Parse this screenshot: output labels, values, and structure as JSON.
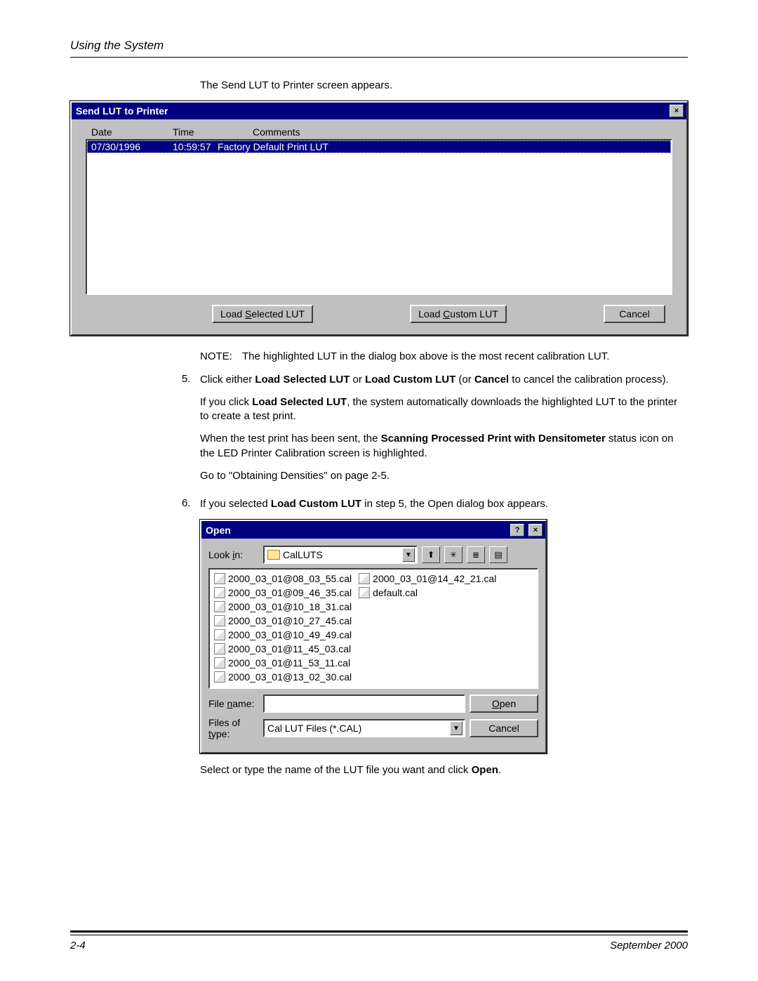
{
  "header": {
    "title": "Using the System"
  },
  "intro": "The Send LUT to Printer screen appears.",
  "dlg1": {
    "title": "Send LUT to Printer",
    "close": "×",
    "cols": {
      "date": "Date",
      "time": "Time",
      "comments": "Comments"
    },
    "row": {
      "date": "07/30/1996",
      "time": "10:59:57",
      "comments": "Factory Default Print LUT"
    },
    "btn_load_sel_pre": "Load ",
    "btn_load_sel_u": "S",
    "btn_load_sel_post": "elected LUT",
    "btn_load_cus_pre": "Load ",
    "btn_load_cus_u": "C",
    "btn_load_cus_post": "ustom LUT",
    "btn_cancel": "Cancel"
  },
  "note": {
    "label": "NOTE:",
    "text": "The highlighted LUT in the dialog box above is the most recent calibration LUT."
  },
  "step5": {
    "num": "5.",
    "p1a": "Click either ",
    "p1b": "Load Selected LUT",
    "p1c": " or ",
    "p1d": "Load Custom LUT",
    "p1e": " (or ",
    "p1f": "Cancel",
    "p1g": " to cancel the calibration process).",
    "p2a": "If you click ",
    "p2b": "Load Selected LUT",
    "p2c": ", the system automatically downloads the highlighted LUT to the printer to create a test print.",
    "p3a": "When the test print has been sent, the ",
    "p3b": "Scanning Processed Print with Densitometer",
    "p3c": " status icon on the LED Printer Calibration screen is highlighted.",
    "p4": "Go to \"Obtaining Densities\" on page 2-5."
  },
  "step6": {
    "num": "6.",
    "p1a": "If you selected ",
    "p1b": "Load Custom LUT",
    "p1c": " in step 5, the Open dialog box appears."
  },
  "openDlg": {
    "title": "Open",
    "help": "?",
    "close": "×",
    "lookin_pre": "Look ",
    "lookin_u": "i",
    "lookin_post": "n:",
    "folder": "CalLUTS",
    "files": [
      "2000_03_01@08_03_55.cal",
      "2000_03_01@09_46_35.cal",
      "2000_03_01@10_18_31.cal",
      "2000_03_01@10_27_45.cal",
      "2000_03_01@10_49_49.cal",
      "2000_03_01@11_45_03.cal",
      "2000_03_01@11_53_11.cal",
      "2000_03_01@13_02_30.cal",
      "2000_03_01@14_42_21.cal",
      "default.cal"
    ],
    "filename_pre": "File ",
    "filename_u": "n",
    "filename_post": "ame:",
    "filetype_pre": "Files of ",
    "filetype_u": "t",
    "filetype_post": "ype:",
    "filetype_val": "Cal LUT Files (*.CAL)",
    "open_u": "O",
    "open_post": "pen",
    "cancel": "Cancel"
  },
  "after_open_a": "Select or type the name of the LUT file you want and click ",
  "after_open_b": "Open",
  "after_open_c": ".",
  "footer": {
    "left": "2-4",
    "right": "September 2000"
  }
}
